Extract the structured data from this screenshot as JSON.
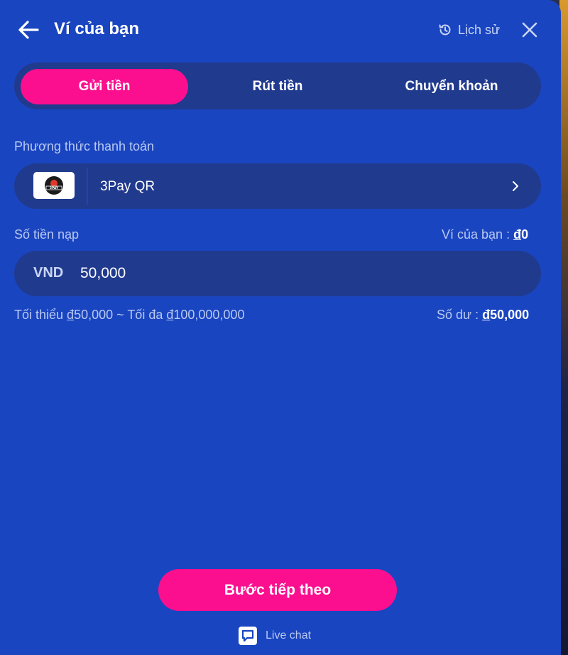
{
  "header": {
    "title": "Ví của bạn",
    "history_label": "Lịch sử"
  },
  "tabs": [
    {
      "label": "Gửi tiền",
      "active": true
    },
    {
      "label": "Rút tiền",
      "active": false
    },
    {
      "label": "Chuyển khoản",
      "active": false
    }
  ],
  "payment": {
    "section_label": "Phương thức thanh toán",
    "method_name": "3Pay QR",
    "logo_text": "3PAY"
  },
  "amount": {
    "label": "Số tiền nạp",
    "wallet_label": "Ví của bạn :",
    "wallet_currency": "đ",
    "wallet_value": "0",
    "currency": "VND",
    "value": "50,000",
    "limits_prefix_min": "Tối thiểu ",
    "min_currency": "đ",
    "min_value": "50,000",
    "limits_sep": " ~ Tối đa ",
    "max_currency": "đ",
    "max_value": "100,000,000",
    "balance_label": "Số dư :",
    "balance_currency": "đ",
    "balance_value": "50,000"
  },
  "footer": {
    "next_label": "Bước tiếp theo",
    "livechat_label": "Live chat"
  },
  "colors": {
    "panel": "#1a45c0",
    "accent": "#fb0f8f",
    "field": "#203a8e"
  },
  "icons": {
    "back": "arrow-left-icon",
    "history": "history-icon",
    "close": "close-icon",
    "chevron": "chevron-right-icon",
    "chat": "chat-icon"
  }
}
